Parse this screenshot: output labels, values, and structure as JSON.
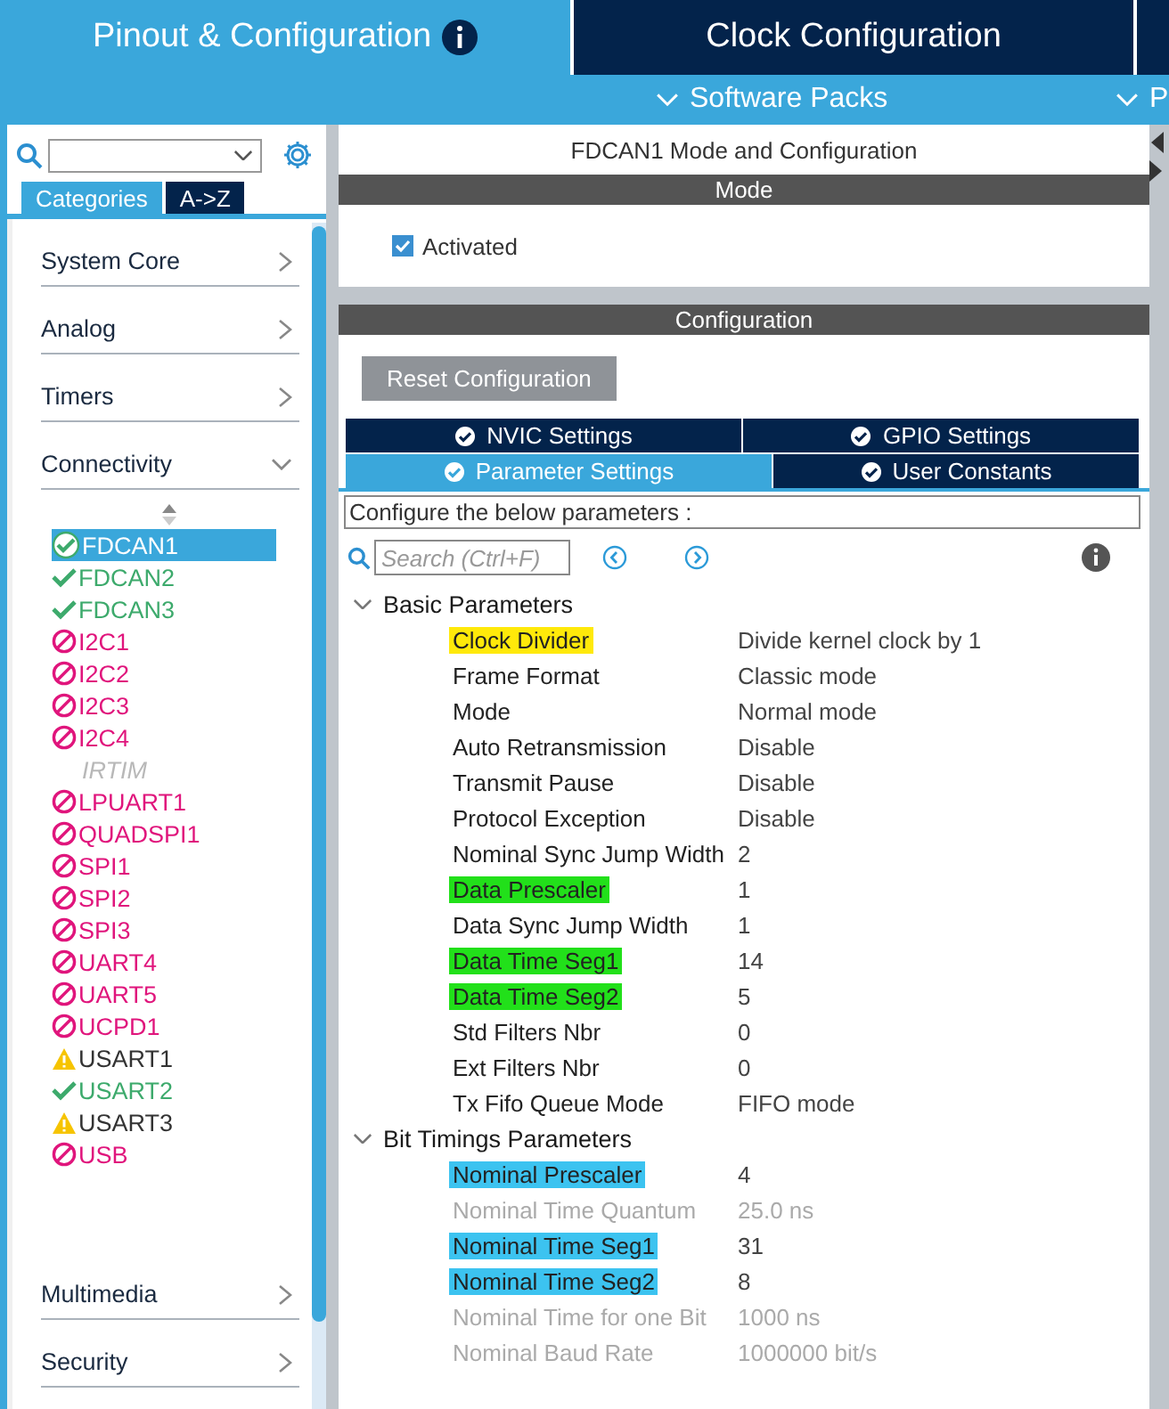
{
  "top_tabs": [
    {
      "label": "Pinout & Configuration",
      "selected": true
    },
    {
      "label": "Clock Configuration",
      "selected": false
    }
  ],
  "menu_bar": [
    {
      "label": "Software Packs"
    },
    {
      "label": "P"
    }
  ],
  "sidebar": {
    "view_tabs": [
      {
        "label": "Categories",
        "selected": true
      },
      {
        "label": "A->Z",
        "selected": false
      }
    ],
    "categories": [
      {
        "label": "System Core",
        "expanded": false
      },
      {
        "label": "Analog",
        "expanded": false
      },
      {
        "label": "Timers",
        "expanded": false
      },
      {
        "label": "Connectivity",
        "expanded": true,
        "children": [
          {
            "label": "FDCAN1",
            "kind": "ok",
            "selected": true
          },
          {
            "label": "FDCAN2",
            "kind": "ok",
            "selected": false
          },
          {
            "label": "FDCAN3",
            "kind": "ok",
            "selected": false
          },
          {
            "label": "I2C1",
            "kind": "blocked",
            "selected": false
          },
          {
            "label": "I2C2",
            "kind": "blocked",
            "selected": false
          },
          {
            "label": "I2C3",
            "kind": "blocked",
            "selected": false
          },
          {
            "label": "I2C4",
            "kind": "blocked",
            "selected": false
          },
          {
            "label": "IRTIM",
            "kind": "unavailable",
            "selected": false
          },
          {
            "label": "LPUART1",
            "kind": "blocked",
            "selected": false
          },
          {
            "label": "QUADSPI1",
            "kind": "blocked",
            "selected": false
          },
          {
            "label": "SPI1",
            "kind": "blocked",
            "selected": false
          },
          {
            "label": "SPI2",
            "kind": "blocked",
            "selected": false
          },
          {
            "label": "SPI3",
            "kind": "blocked",
            "selected": false
          },
          {
            "label": "UART4",
            "kind": "blocked",
            "selected": false
          },
          {
            "label": "UART5",
            "kind": "blocked",
            "selected": false
          },
          {
            "label": "UCPD1",
            "kind": "blocked",
            "selected": false
          },
          {
            "label": "USART1",
            "kind": "warning",
            "selected": false
          },
          {
            "label": "USART2",
            "kind": "ok",
            "selected": false
          },
          {
            "label": "USART3",
            "kind": "warning",
            "selected": false
          },
          {
            "label": "USB",
            "kind": "blocked",
            "selected": false
          }
        ]
      },
      {
        "label": "Multimedia",
        "expanded": false
      },
      {
        "label": "Security",
        "expanded": false
      }
    ]
  },
  "panel": {
    "title": "FDCAN1 Mode and Configuration",
    "mode_header": "Mode",
    "activated": {
      "label": "Activated",
      "checked": true
    },
    "config_header": "Configuration",
    "reset_button": "Reset Configuration",
    "config_tabs": [
      [
        {
          "label": "NVIC Settings",
          "selected": false
        },
        {
          "label": "GPIO Settings",
          "selected": false
        }
      ],
      [
        {
          "label": "Parameter Settings",
          "selected": true
        },
        {
          "label": "User Constants",
          "selected": false
        }
      ]
    ],
    "hint": "Configure the below parameters :",
    "search": {
      "placeholder": "Search (Ctrl+F)"
    },
    "groups": [
      {
        "label": "Basic Parameters",
        "expanded": true,
        "parameters": [
          {
            "name": "Clock Divider",
            "value": "Divide kernel clock by 1",
            "disabled": false,
            "color": "#ffe90a"
          },
          {
            "name": "Frame Format",
            "value": "Classic mode",
            "disabled": false
          },
          {
            "name": "Mode",
            "value": "Normal mode",
            "disabled": false
          },
          {
            "name": "Auto Retransmission",
            "value": "Disable",
            "disabled": false
          },
          {
            "name": "Transmit Pause",
            "value": "Disable",
            "disabled": false
          },
          {
            "name": "Protocol Exception",
            "value": "Disable",
            "disabled": false
          },
          {
            "name": "Nominal Sync Jump Width",
            "value": "2",
            "disabled": false
          },
          {
            "name": "Data Prescaler",
            "value": "1",
            "disabled": false,
            "color": "#22e01a"
          },
          {
            "name": "Data Sync Jump Width",
            "value": "1",
            "disabled": false
          },
          {
            "name": "Data Time Seg1",
            "value": "14",
            "disabled": false,
            "color": "#22e01a"
          },
          {
            "name": "Data Time Seg2",
            "value": "5",
            "disabled": false,
            "color": "#22e01a"
          },
          {
            "name": "Std Filters Nbr",
            "value": "0",
            "disabled": false
          },
          {
            "name": "Ext Filters Nbr",
            "value": "0",
            "disabled": false
          },
          {
            "name": "Tx Fifo Queue Mode",
            "value": "FIFO mode",
            "disabled": false
          }
        ]
      },
      {
        "label": "Bit Timings Parameters",
        "expanded": true,
        "parameters": [
          {
            "name": "Nominal Prescaler",
            "value": "4",
            "disabled": false,
            "color": "#3cc3f0"
          },
          {
            "name": "Nominal Time Quantum",
            "value": "25.0 ns",
            "disabled": true
          },
          {
            "name": "Nominal Time Seg1",
            "value": "31",
            "disabled": false,
            "color": "#3cc3f0"
          },
          {
            "name": "Nominal Time Seg2",
            "value": "8",
            "disabled": false,
            "color": "#3cc3f0"
          },
          {
            "name": "Nominal Time for one Bit",
            "value": "1000 ns",
            "disabled": true
          },
          {
            "name": "Nominal Baud Rate",
            "value": "1000000 bit/s",
            "disabled": true
          }
        ]
      }
    ]
  }
}
